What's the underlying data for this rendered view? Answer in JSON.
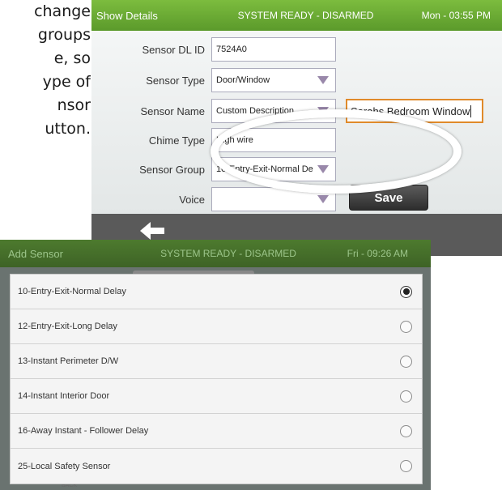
{
  "tutorial": {
    "lines": [
      "change",
      "groups",
      "e, so",
      "ype of",
      "nsor",
      "utton."
    ]
  },
  "show_details": {
    "header": {
      "title": "Show Details",
      "status": "SYSTEM READY - DISARMED",
      "time": "Mon - 03:55 PM"
    },
    "fields": {
      "dl_id_label": "Sensor DL ID",
      "dl_id_value": "7524A0",
      "type_label": "Sensor Type",
      "type_value": "Door/Window",
      "name_label": "Sensor Name",
      "name_value": "Custom Description",
      "name_custom": "Sarahs Bedroom Window",
      "chime_label": "Chime Type",
      "chime_value": "High wire",
      "group_label": "Sensor Group",
      "group_value": "10-Entry-Exit-Normal De",
      "voice_label": "Voice",
      "voice_value": ""
    },
    "save_label": "Save",
    "colors": {
      "header": "#6aaa35",
      "name_focus_border": "#e08a2a"
    }
  },
  "add_sensor": {
    "header": {
      "title": "Add Sensor",
      "status": "SYSTEM READY - DISARMED",
      "time": "Fri - 09:26 AM"
    },
    "back_label": "BACK",
    "options": [
      {
        "label": "10-Entry-Exit-Normal Delay",
        "selected": true
      },
      {
        "label": "12-Entry-Exit-Long Delay",
        "selected": false
      },
      {
        "label": "13-Instant Perimeter D/W",
        "selected": false
      },
      {
        "label": "14-Instant Interior Door",
        "selected": false
      },
      {
        "label": "16-Away Instant - Follower Delay",
        "selected": false
      },
      {
        "label": "25-Local Safety Sensor",
        "selected": false
      }
    ]
  }
}
